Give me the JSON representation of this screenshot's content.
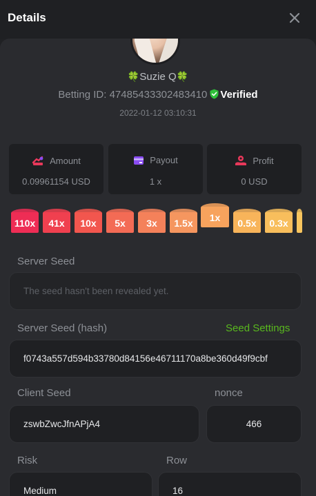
{
  "header": {
    "title": "Details"
  },
  "user": {
    "name": "Suzie Q",
    "clover": "🍀"
  },
  "bet": {
    "id_label": "Betting ID: 47485433302483410",
    "verified": "Verified",
    "date": "2022-01-12 03:10:31"
  },
  "stats": [
    {
      "label": "Amount",
      "value": "0.09961154 USD",
      "icon": "amount-icon",
      "color": "#e8385a"
    },
    {
      "label": "Payout",
      "value": "1 x",
      "icon": "payout-card-icon",
      "color": "#8a4cf2"
    },
    {
      "label": "Profit",
      "value": "0 USD",
      "icon": "profit-icon",
      "color": "#e8385a"
    }
  ],
  "multipliers": [
    {
      "label": "110x",
      "color": "#ee2d55"
    },
    {
      "label": "41x",
      "color": "#f0404f"
    },
    {
      "label": "10x",
      "color": "#f2564e"
    },
    {
      "label": "5x",
      "color": "#f36b55"
    },
    {
      "label": "3x",
      "color": "#f4815a"
    },
    {
      "label": "1.5x",
      "color": "#f5965f"
    },
    {
      "label": "1x",
      "color": "#f7a35d"
    },
    {
      "label": "0.5x",
      "color": "#f8b45a"
    },
    {
      "label": "0.3x",
      "color": "#f8be5c"
    },
    {
      "label": "",
      "color": "#f9c55e"
    }
  ],
  "seeds": {
    "server_seed_label": "Server Seed",
    "server_seed_placeholder": "The seed hasn't been revealed yet.",
    "server_hash_label": "Server Seed (hash)",
    "seed_settings": "Seed Settings",
    "server_hash": "f0743a557d594b33780d84156e46711170a8be360d49f9cbf",
    "client_seed_label": "Client Seed",
    "client_seed": "zswbZwcJfnAPjA4",
    "nonce_label": "nonce",
    "nonce": "466",
    "risk_label": "Risk",
    "risk": "Medium",
    "row_label": "Row",
    "row": "16"
  }
}
